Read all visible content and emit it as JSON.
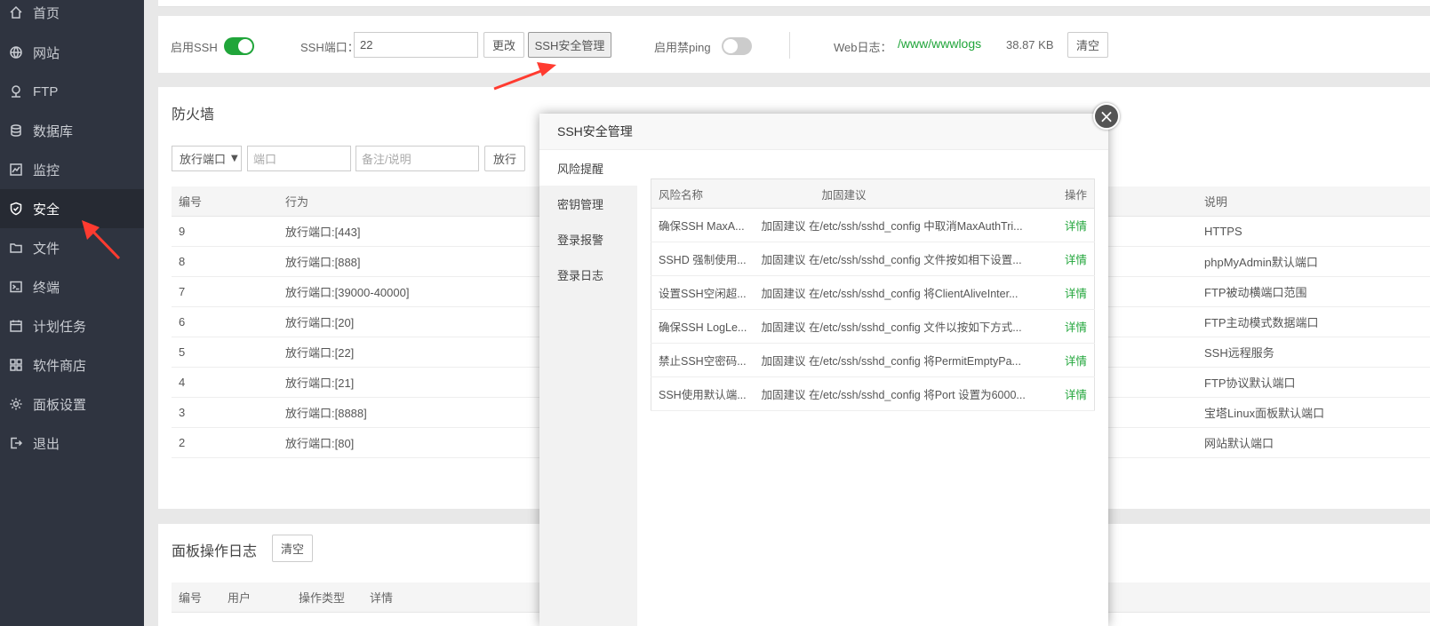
{
  "sidebar": {
    "items": [
      {
        "label": "首页",
        "icon": "home-icon"
      },
      {
        "label": "网站",
        "icon": "globe-icon"
      },
      {
        "label": "FTP",
        "icon": "ftp-icon"
      },
      {
        "label": "数据库",
        "icon": "database-icon"
      },
      {
        "label": "监控",
        "icon": "monitor-icon"
      },
      {
        "label": "安全",
        "icon": "shield-icon",
        "active": true
      },
      {
        "label": "文件",
        "icon": "folder-icon"
      },
      {
        "label": "终端",
        "icon": "terminal-icon"
      },
      {
        "label": "计划任务",
        "icon": "calendar-icon"
      },
      {
        "label": "软件商店",
        "icon": "grid-icon"
      },
      {
        "label": "面板设置",
        "icon": "gear-icon"
      },
      {
        "label": "退出",
        "icon": "logout-icon"
      }
    ]
  },
  "ssh": {
    "enable_label": "启用SSH",
    "enabled": true,
    "port_label": "SSH端口：",
    "port_value": "22",
    "change_button": "更改",
    "manage_button": "SSH安全管理",
    "ping_label": "启用禁ping",
    "ping_enabled": false,
    "weblog_label": "Web日志：",
    "weblog_path": "/www/wwwlogs",
    "weblog_size": "38.87 KB",
    "clear_button": "清空"
  },
  "firewall": {
    "title": "防火墙",
    "select_value": "放行端口",
    "port_placeholder": "端口",
    "note_placeholder": "备注/说明",
    "allow_button": "放行",
    "columns": [
      "编号",
      "行为",
      "说明"
    ],
    "rows": [
      {
        "id": "9",
        "action": "放行端口:[443]",
        "note": "HTTPS"
      },
      {
        "id": "8",
        "action": "放行端口:[888]",
        "note": "phpMyAdmin默认端口"
      },
      {
        "id": "7",
        "action": "放行端口:[39000-40000]",
        "note": "FTP被动横端口范围"
      },
      {
        "id": "6",
        "action": "放行端口:[20]",
        "note": "FTP主动模式数据端口"
      },
      {
        "id": "5",
        "action": "放行端口:[22]",
        "note": "SSH远程服务"
      },
      {
        "id": "4",
        "action": "放行端口:[21]",
        "note": "FTP协议默认端口"
      },
      {
        "id": "3",
        "action": "放行端口:[8888]",
        "note": "宝塔Linux面板默认端口"
      },
      {
        "id": "2",
        "action": "放行端口:[80]",
        "note": "网站默认端口"
      }
    ]
  },
  "panel_log": {
    "title": "面板操作日志",
    "clear_button": "清空",
    "columns": [
      "编号",
      "用户",
      "操作类型",
      "详情"
    ]
  },
  "modal": {
    "title": "SSH安全管理",
    "tabs": [
      "风险提醒",
      "密钥管理",
      "登录报警",
      "登录日志"
    ],
    "columns": [
      "风险名称",
      "加固建议",
      "操作"
    ],
    "rows": [
      {
        "name": "确保SSH MaxA...",
        "advice": "加固建议 在/etc/ssh/sshd_config 中取消MaxAuthTri...",
        "action": "详情"
      },
      {
        "name": "SSHD 强制使用...",
        "advice": "加固建议 在/etc/ssh/sshd_config 文件按如相下设置...",
        "action": "详情"
      },
      {
        "name": "设置SSH空闲超...",
        "advice": "加固建议 在/etc/ssh/sshd_config 将ClientAliveInter...",
        "action": "详情"
      },
      {
        "name": "确保SSH LogLe...",
        "advice": "加固建议 在/etc/ssh/sshd_config 文件以按如下方式...",
        "action": "详情"
      },
      {
        "name": "禁止SSH空密码...",
        "advice": "加固建议 在/etc/ssh/sshd_config 将PermitEmptyPa...",
        "action": "详情"
      },
      {
        "name": "SSH使用默认端...",
        "advice": "加固建议 在/etc/ssh/sshd_config 将Port 设置为6000...",
        "action": "详情"
      }
    ]
  },
  "colors": {
    "sidebar_bg": "#2f3440",
    "accent_green": "#20a53a",
    "annotation_red": "#ff3b30"
  }
}
